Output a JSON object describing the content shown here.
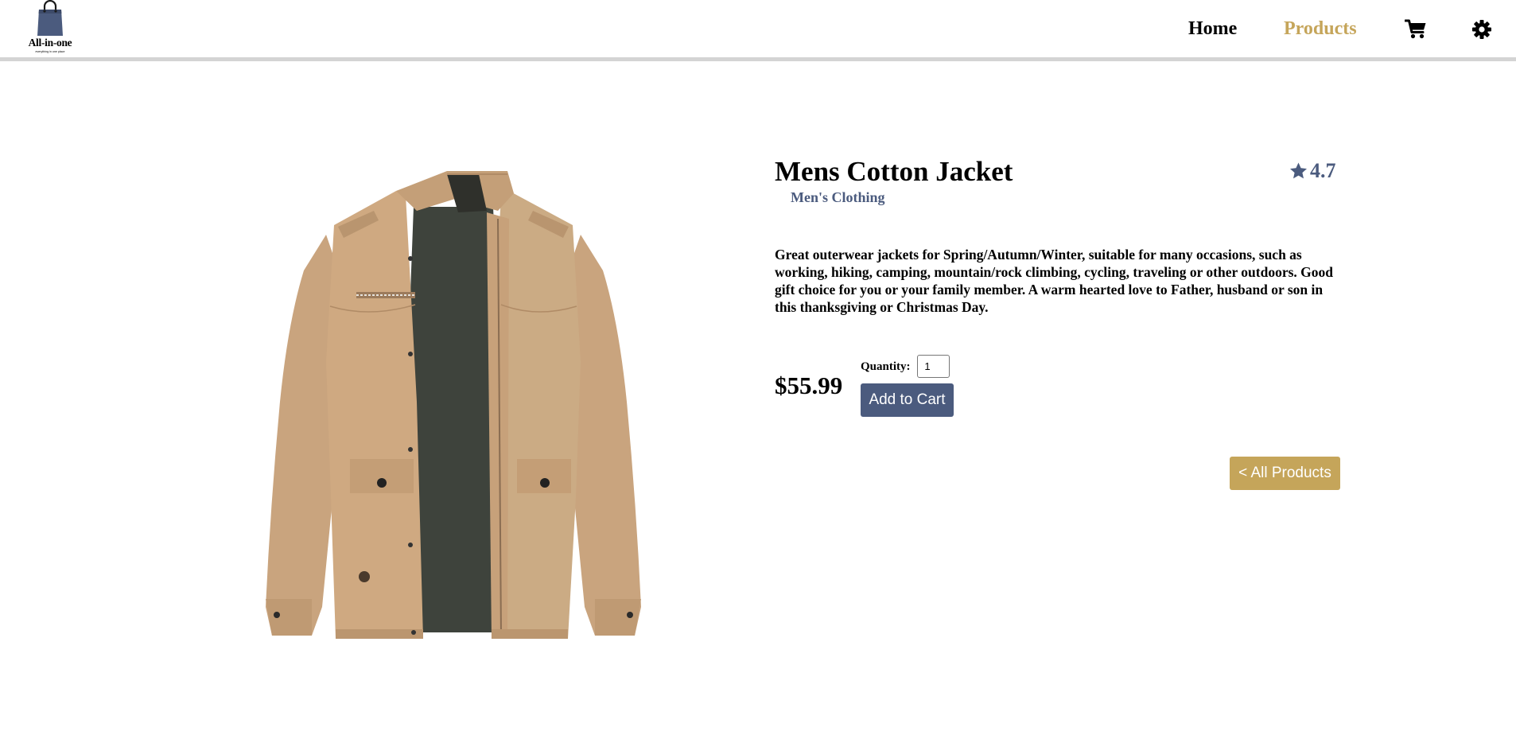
{
  "header": {
    "logo": {
      "brand": "All-in-one",
      "tagline": "everything in one place"
    },
    "nav": {
      "home": "Home",
      "products": "Products",
      "cart_icon": "shopping-cart-icon",
      "settings_icon": "gear-icon"
    }
  },
  "product": {
    "title": "Mens Cotton Jacket",
    "category": "Men's Clothing",
    "rating": "4.7",
    "rating_icon": "star-icon",
    "description": "Great outerwear jackets for Spring/Autumn/Winter, suitable for many occasions, such as working, hiking, camping, mountain/rock climbing, cycling, traveling or other outdoors. Good gift choice for you or your family member. A warm hearted love to Father, husband or son in this thanksgiving or Christmas Day.",
    "price": "$55.99",
    "quantity_label": "Quantity:",
    "quantity_value": "1",
    "add_to_cart_label": "Add to Cart",
    "back_label": "< All Products"
  },
  "colors": {
    "accent_gold": "#c5a55a",
    "primary_navy": "#4b5b7e",
    "header_border": "#d4d4d4"
  }
}
